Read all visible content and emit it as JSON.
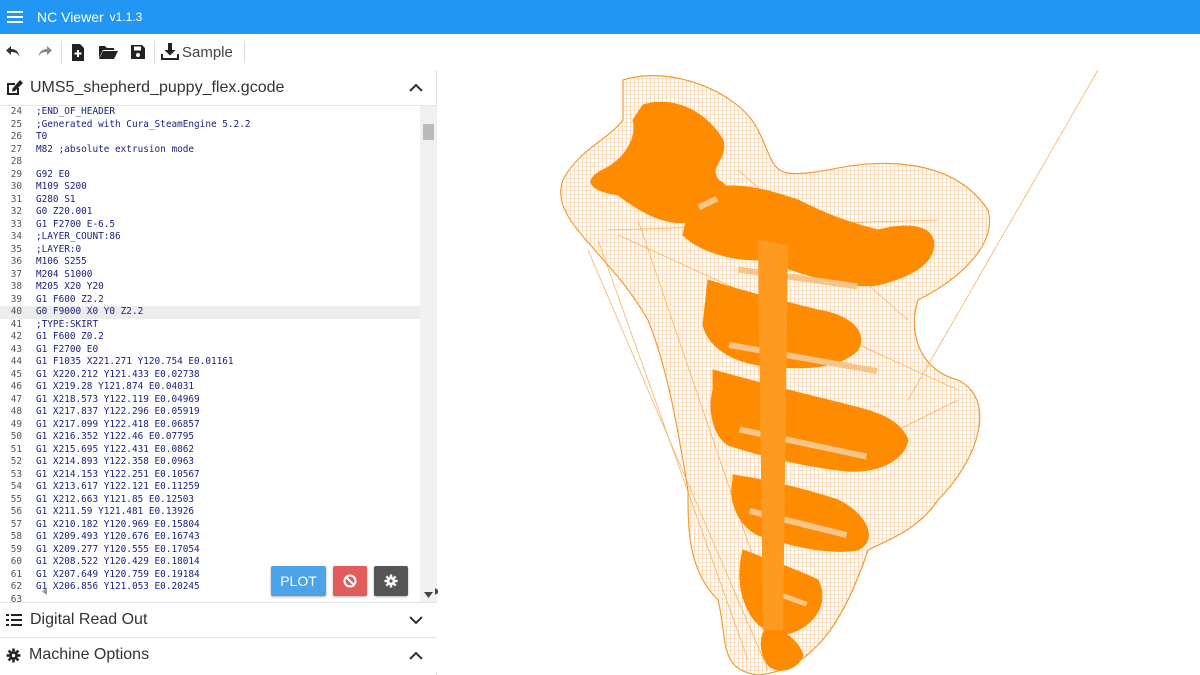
{
  "app": {
    "title": "NC Viewer",
    "version": "v1.1.3"
  },
  "toolbar": {
    "sample_label": "Sample"
  },
  "editor": {
    "filename": "UMS5_shepherd_puppy_flex.gcode",
    "lines": [
      {
        "n": "24",
        "t": ";END_OF_HEADER"
      },
      {
        "n": "25",
        "t": ";Generated with Cura_SteamEngine 5.2.2"
      },
      {
        "n": "26",
        "t": "T0"
      },
      {
        "n": "27",
        "t": "M82 ;absolute extrusion mode"
      },
      {
        "n": "28",
        "t": ""
      },
      {
        "n": "29",
        "t": "G92 E0"
      },
      {
        "n": "30",
        "t": "M109 S200"
      },
      {
        "n": "31",
        "t": "G280 S1"
      },
      {
        "n": "32",
        "t": "G0 Z20.001"
      },
      {
        "n": "33",
        "t": "G1 F2700 E-6.5"
      },
      {
        "n": "34",
        "t": ";LAYER_COUNT:86"
      },
      {
        "n": "35",
        "t": ";LAYER:0"
      },
      {
        "n": "36",
        "t": "M106 S255"
      },
      {
        "n": "37",
        "t": "M204 S1000"
      },
      {
        "n": "38",
        "t": "M205 X20 Y20"
      },
      {
        "n": "39",
        "t": "G1 F600 Z2.2"
      },
      {
        "n": "40",
        "t": "G0 F9000 X0 Y0 Z2.2"
      },
      {
        "n": "41",
        "t": ";TYPE:SKIRT"
      },
      {
        "n": "42",
        "t": "G1 F600 Z0.2"
      },
      {
        "n": "43",
        "t": "G1 F2700 E0"
      },
      {
        "n": "44",
        "t": "G1 F1035 X221.271 Y120.754 E0.01161"
      },
      {
        "n": "45",
        "t": "G1 X220.212 Y121.433 E0.02738"
      },
      {
        "n": "46",
        "t": "G1 X219.28 Y121.874 E0.04031"
      },
      {
        "n": "47",
        "t": "G1 X218.573 Y122.119 E0.04969"
      },
      {
        "n": "48",
        "t": "G1 X217.837 Y122.296 E0.05919"
      },
      {
        "n": "49",
        "t": "G1 X217.099 Y122.418 E0.06857"
      },
      {
        "n": "50",
        "t": "G1 X216.352 Y122.46 E0.07795"
      },
      {
        "n": "51",
        "t": "G1 X215.695 Y122.431 E0.0862"
      },
      {
        "n": "52",
        "t": "G1 X214.893 Y122.358 E0.0963"
      },
      {
        "n": "53",
        "t": "G1 X214.153 Y122.251 E0.10567"
      },
      {
        "n": "54",
        "t": "G1 X213.617 Y122.121 E0.11259"
      },
      {
        "n": "55",
        "t": "G1 X212.663 Y121.85 E0.12503"
      },
      {
        "n": "56",
        "t": "G1 X211.59 Y121.481 E0.13926"
      },
      {
        "n": "57",
        "t": "G1 X210.182 Y120.969 E0.15804"
      },
      {
        "n": "58",
        "t": "G1 X209.493 Y120.676 E0.16743"
      },
      {
        "n": "59",
        "t": "G1 X209.277 Y120.555 E0.17054"
      },
      {
        "n": "60",
        "t": "G1 X208.522 Y120.429 E0.18014"
      },
      {
        "n": "61",
        "t": "G1 X207.649 Y120.759 E0.19184"
      },
      {
        "n": "62",
        "t": "G1 X206.856 Y121.053 E0.20245"
      },
      {
        "n": "63",
        "t": ""
      }
    ],
    "active_line": "40"
  },
  "buttons": {
    "plot_label": "PLOT"
  },
  "panels": {
    "dro_label": "Digital Read Out",
    "machine_label": "Machine Options"
  },
  "colors": {
    "accent": "#2196f3",
    "toolpath": "#ff8c00",
    "plot": "#4da3e8",
    "stop": "#e25c5c"
  },
  "icons": [
    "menu-icon",
    "undo-icon",
    "redo-icon",
    "new-file-icon",
    "open-folder-icon",
    "save-icon",
    "download-icon",
    "edit-icon",
    "chevron-up-icon",
    "chevron-down-icon",
    "list-icon",
    "gear-icon",
    "stop-icon"
  ]
}
